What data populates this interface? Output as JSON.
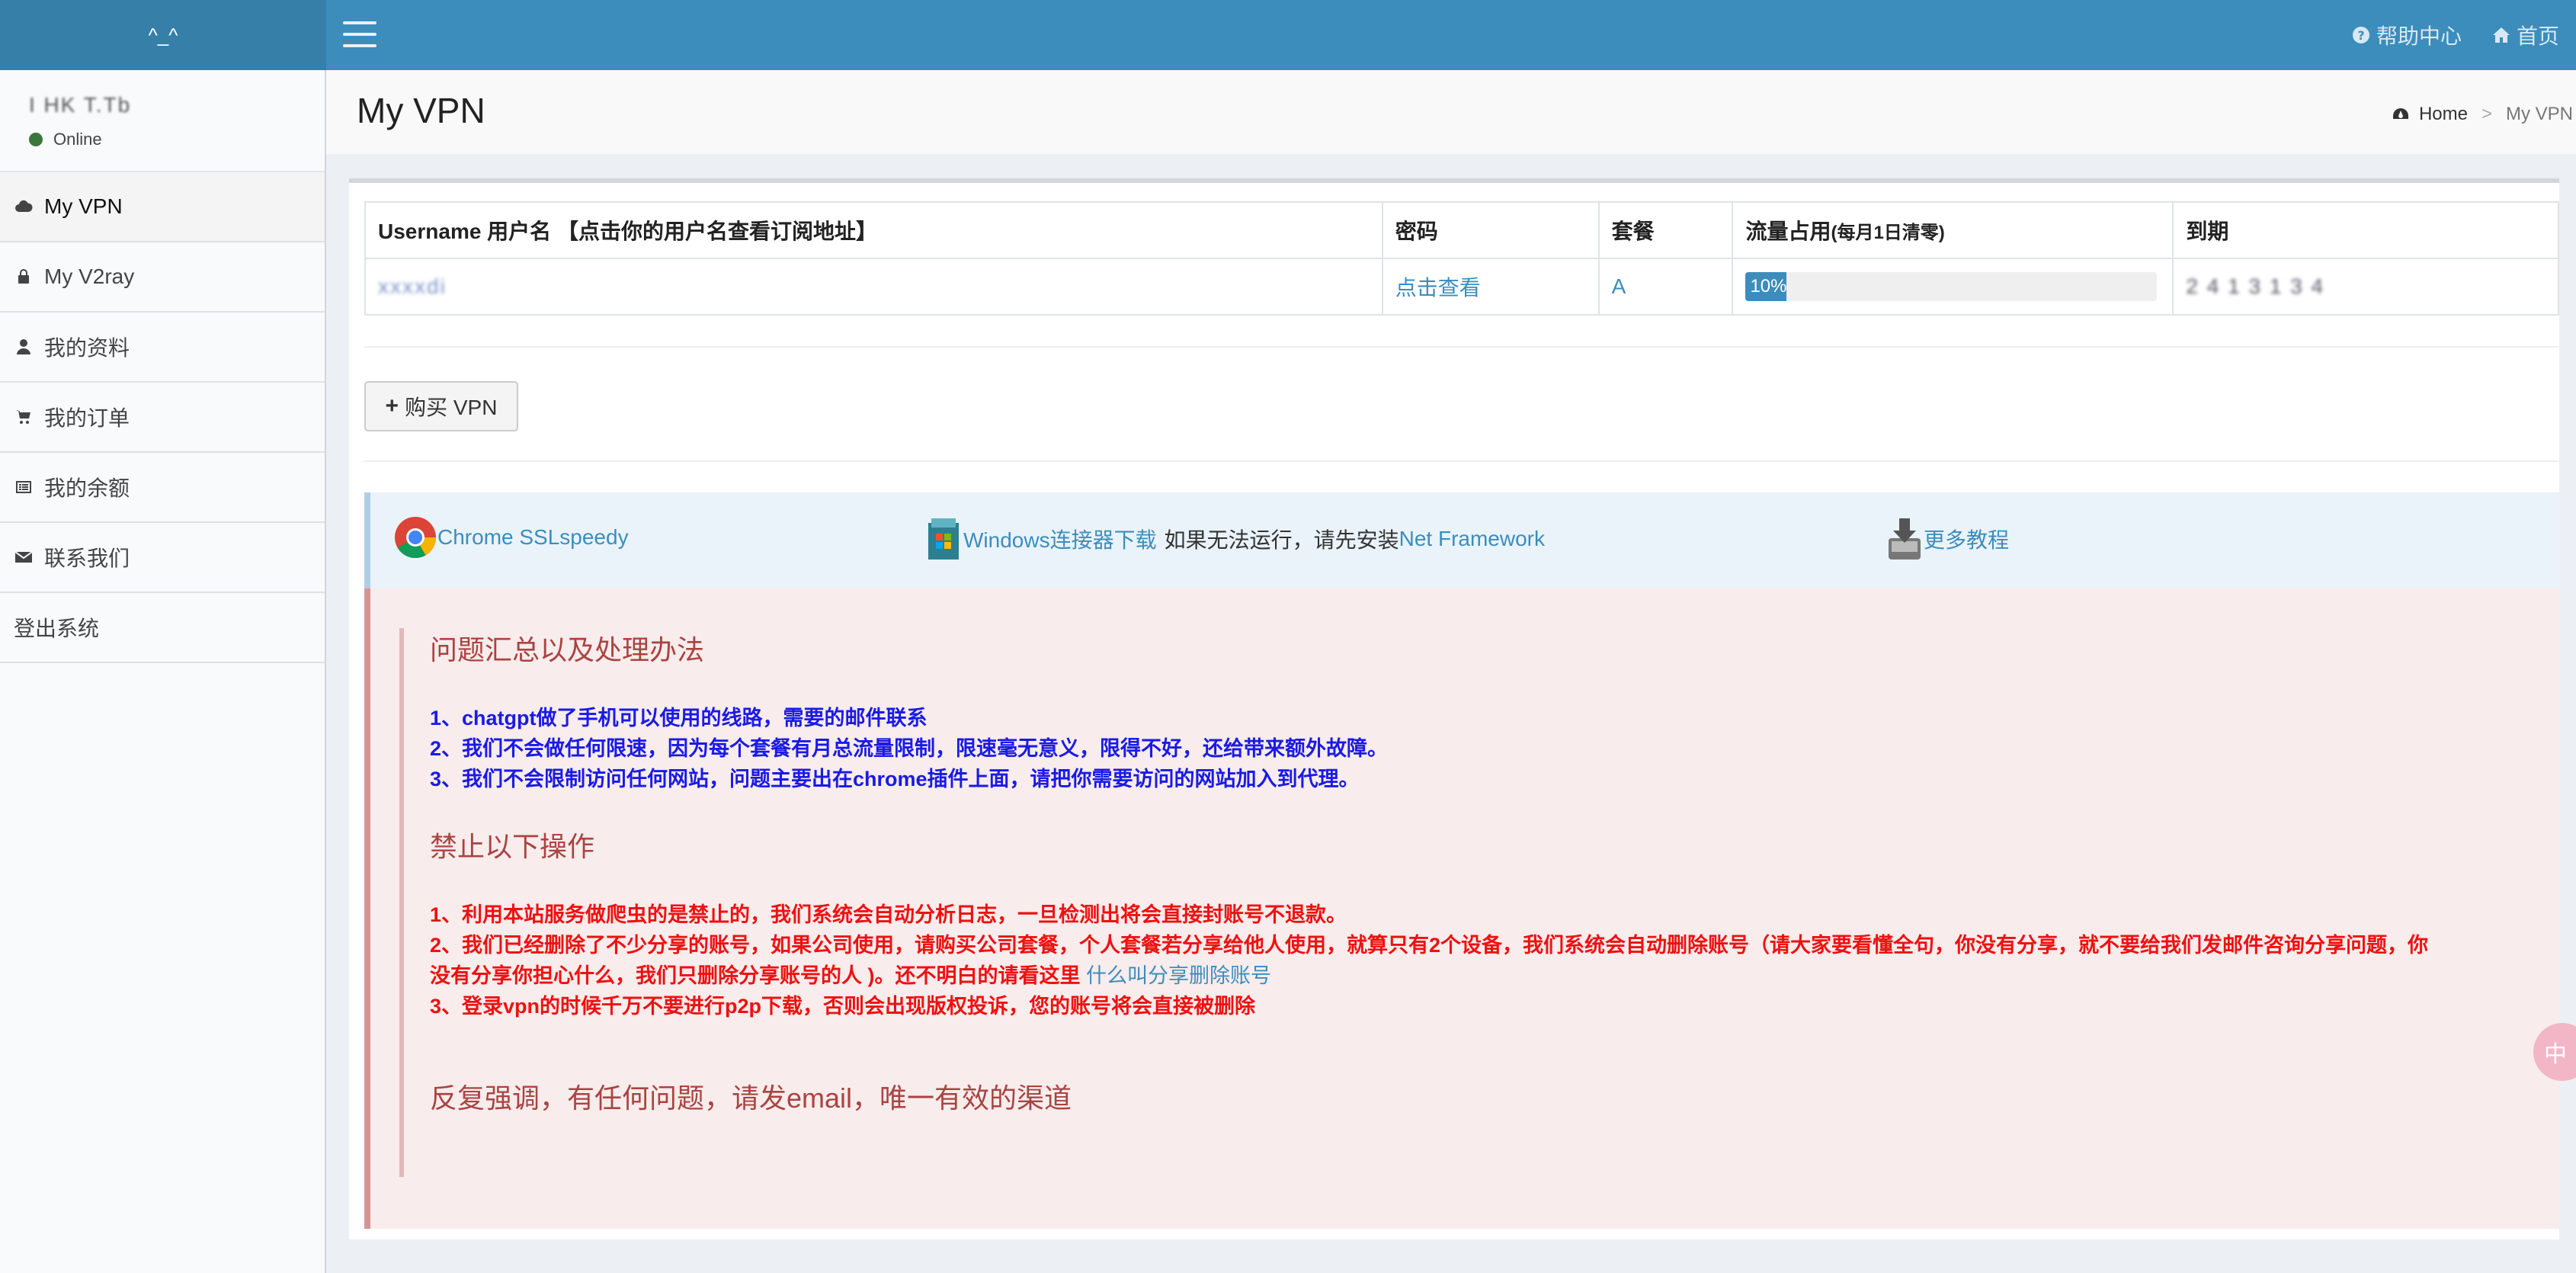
{
  "app": {
    "logo_text": "^_^"
  },
  "header": {
    "links": [
      {
        "label": "帮助中心",
        "icon": "question-circle-icon"
      },
      {
        "label": "首页",
        "icon": "home-icon"
      }
    ]
  },
  "sidebar": {
    "user": {
      "name": "I HK T.Tb",
      "status": "Online",
      "status_color": "#3c763d"
    },
    "items": [
      {
        "label": "My VPN",
        "icon": "cloud-icon"
      },
      {
        "label": "My V2ray",
        "icon": "lock-icon"
      },
      {
        "label": "我的资料",
        "icon": "user-icon"
      },
      {
        "label": "我的订单",
        "icon": "cart-icon"
      },
      {
        "label": "我的余额",
        "icon": "list-icon"
      },
      {
        "label": "联系我们",
        "icon": "envelope-icon"
      },
      {
        "label": "登出系统",
        "icon": ""
      }
    ]
  },
  "page": {
    "title": "My VPN",
    "breadcrumb": [
      "Home",
      ">",
      "My VPN"
    ]
  },
  "table": {
    "headers": [
      "Username 用户名 【点击你的用户名查看订阅地址】",
      "密码",
      "套餐",
      "流量占用",
      "(每月1日清零)",
      "到期"
    ],
    "row": {
      "username": "xxxxdi",
      "password_link": "点击查看",
      "plan": "A",
      "usage_text": "10%",
      "usage_fraction": 0.1,
      "expiry": "2 4 1 3 1 3 4"
    }
  },
  "buy_button": {
    "label": "购买 VPN",
    "icon": "plus-icon"
  },
  "downloads": {
    "chrome": {
      "label": "Chrome SSLspeedy",
      "icon": "chrome-icon"
    },
    "windows": {
      "label": "Windows连接器下载",
      "note": "如果无法运行，请先安装",
      "framework": "Net Framework",
      "icon": "windows-package-icon"
    },
    "more": {
      "label": "更多教程",
      "icon": "download-tray-icon"
    }
  },
  "notice": {
    "heading1": "问题汇总以及处理办法",
    "lines1": [
      "1、chatgpt做了手机可以使用的线路，需要的邮件联系",
      "2、我们不会做任何限速，因为每个套餐有月总流量限制，限速毫无意义，限得不好，还给带来额外故障。",
      "3、我们不会限制访问任何网站，问题主要出在chrome插件上面，请把你需要访问的网站加入到代理。"
    ],
    "heading2": "禁止以下操作",
    "lines2": [
      "1、利用本站服务做爬虫的是禁止的，我们系统会自动分析日志，一旦检测出将会直接封账号不退款。",
      "2、我们已经删除了不少分享的账号，如果公司使用，请购买公司套餐，个人套餐若分享给他人使用，就算只有2个设备，我们系统会自动删除账号（请大家要看懂全句，你没有分享，就不要给我们发邮件咨询分享问题，你没有分享你担心什么，我们只删除分享账号的人 )。还不明白的请看这里",
      "什么叫分享删除账号",
      "3、登录vpn的时候千万不要进行p2p下载，否则会出现版权投诉，您的账号将会直接被删除"
    ],
    "footer": "反复强调，有任何问题，请发email，唯一有效的渠道"
  },
  "floating_badge": {
    "label": "中"
  },
  "colors": {
    "header": "#3c8dbc",
    "logo_bg": "#367fa9",
    "link": "#3c8dbc",
    "notice_blue": "#1a1ae6",
    "notice_red": "#ee1111",
    "notice_heading": "#a94442"
  }
}
